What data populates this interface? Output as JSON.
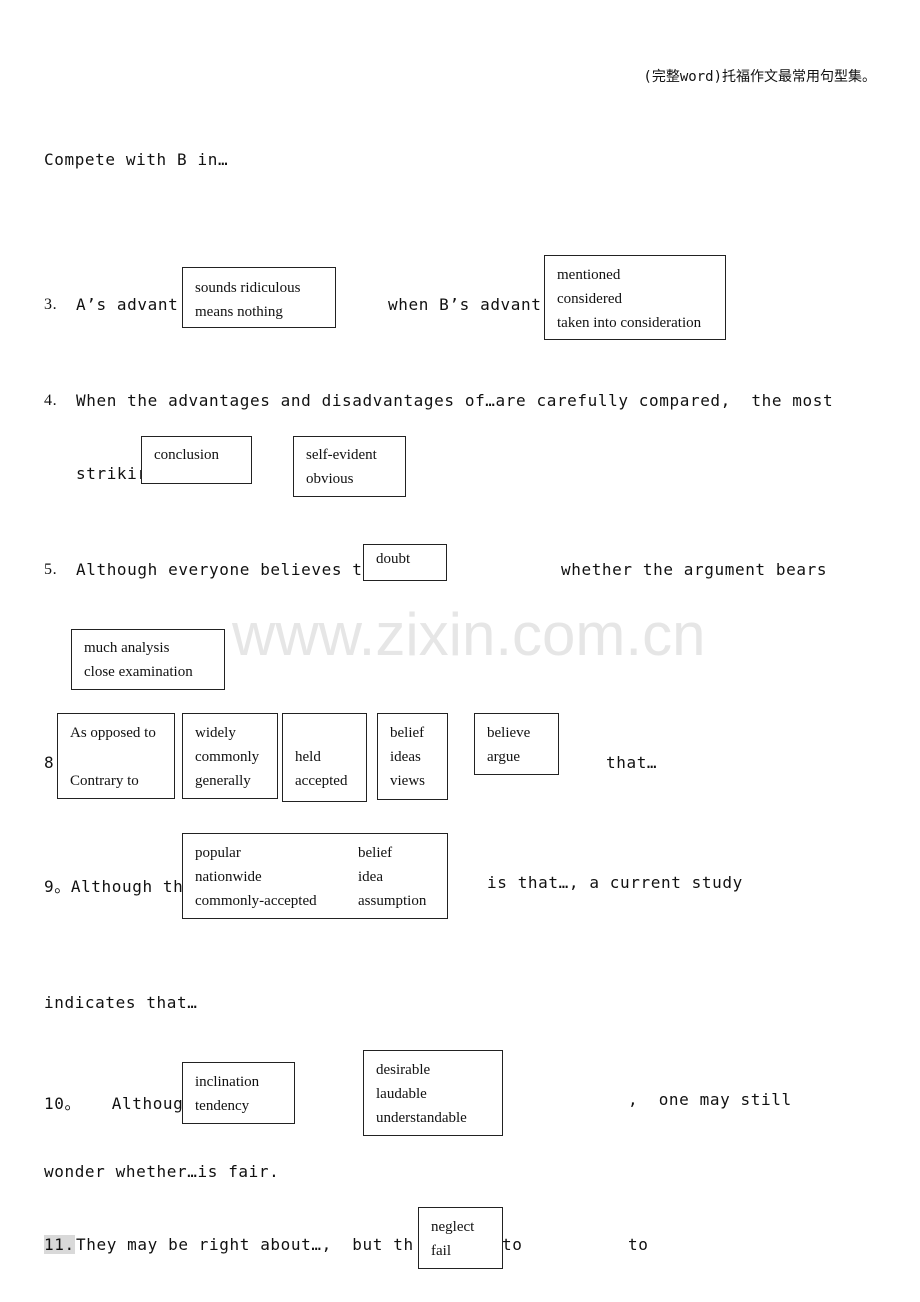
{
  "header": {
    "title": "(完整word)托福作文最常用句型集。"
  },
  "watermark": "www.zixin.com.cn",
  "lines": {
    "compete": "Compete with B in…",
    "s3_num": "3.",
    "s3_a": "A’s advant",
    "s3_b": "when B’s advant",
    "s4_num": "4.",
    "s4_a": "When the advantages and disadvantages of…are carefully compared,  the most",
    "s4_b": "strikir",
    "s5_num": "5.",
    "s5_a": "Although everyone believes th",
    "s5_b": "whether the argument bears",
    "s8_num": "8.",
    "s8_that": "that…",
    "s9_a": "9。Although th",
    "s9_b": "is that…, a current study",
    "s9_c": "indicates that…",
    "s10_a": "10。   Althoug",
    "s10_b": ",  one may still",
    "s10_c": "wonder whether…is fair.",
    "s11_num": "11.",
    "s11_a": "They may be right about…,  but th",
    "s11_b": "to",
    "s11_c": "to"
  },
  "boxes": {
    "b3a": [
      "sounds ridiculous",
      "means nothing"
    ],
    "b3b": [
      "mentioned",
      "considered",
      "taken into consideration"
    ],
    "b4a": [
      "conclusion"
    ],
    "b4b": [
      "self-evident",
      "obvious"
    ],
    "b5a": [
      "doubt"
    ],
    "b5b": [
      "much analysis",
      "close examination"
    ],
    "b8a": [
      "As opposed to",
      "",
      "Contrary to"
    ],
    "b8b": [
      "widely",
      "commonly",
      "generally"
    ],
    "b8c": [
      "held",
      "accepted"
    ],
    "b8d": [
      "belief",
      "ideas",
      "views"
    ],
    "b8e": [
      "believe",
      "argue"
    ],
    "b9": {
      "left": [
        "popular",
        "nationwide",
        "commonly-accepted"
      ],
      "right": [
        "belief",
        "idea",
        "assumption"
      ]
    },
    "b10a": [
      "inclination",
      "tendency"
    ],
    "b10b": [
      "desirable",
      "laudable",
      "understandable"
    ],
    "b11": [
      "neglect",
      "fail"
    ]
  }
}
